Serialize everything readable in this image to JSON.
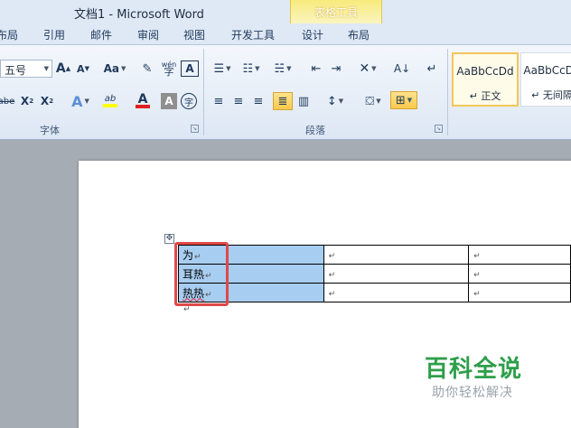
{
  "window": {
    "title": "文档1  -  Microsoft Word",
    "context_group": "表格工具"
  },
  "tabs": [
    "布局",
    "引用",
    "邮件",
    "审阅",
    "视图",
    "开发工具",
    "设计",
    "布局"
  ],
  "ribbon": {
    "font": {
      "size_value": "五号",
      "grow_label": "A",
      "shrink_label": "A",
      "case_label": "Aa",
      "phonetic_label": "wén",
      "border_char_label": "A",
      "strike_label": "abe",
      "subscript_label": "X",
      "superscript_label": "X",
      "effects_label": "A",
      "highlight_label": "ab",
      "font_color_label": "A",
      "shading_char_label": "A",
      "enclose_label": "字",
      "group_label": "字体"
    },
    "paragraph": {
      "group_label": "段落"
    },
    "styles": {
      "tiles": [
        {
          "sample": "AaBbCcDd",
          "name": "↵ 正文"
        },
        {
          "sample": "AaBbCcDd",
          "name": "↵ 无间隔"
        }
      ]
    }
  },
  "document": {
    "rows": [
      {
        "c1": "为",
        "c2": "",
        "c3": "",
        "c4": ""
      },
      {
        "c1": "耳热",
        "c2": "",
        "c3": "",
        "c4": ""
      },
      {
        "c1": "热热",
        "c2": "",
        "c3": "",
        "c4": ""
      }
    ],
    "cell_mark": "↵",
    "paragraph_mark": "↵"
  },
  "watermark": {
    "title": "百科全说",
    "subtitle": "助你轻松解决"
  },
  "colors": {
    "selection": "#a7cdf0",
    "highlight_box": "#e04848",
    "watermark_green": "#2e9e4a",
    "font_color_bar": "#e02020",
    "highlight_bar": "#ffff00"
  }
}
